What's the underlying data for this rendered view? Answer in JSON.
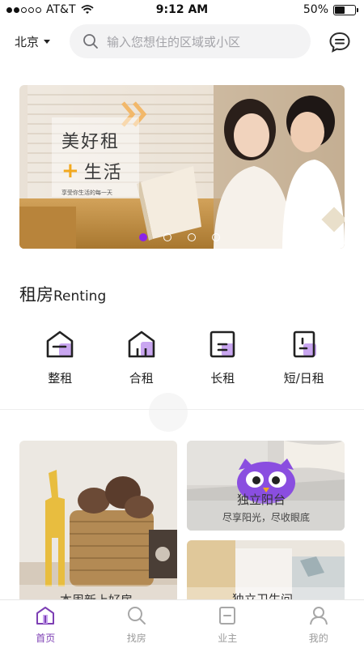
{
  "status_bar": {
    "carrier": "AT&T",
    "time": "9:12 AM",
    "battery": "50%",
    "battery_level": 0.5
  },
  "header": {
    "city": "北京",
    "search_placeholder": "输入您想住的区域或小区",
    "icons": [
      "search-icon",
      "chat-icon",
      "chevron-down-icon"
    ]
  },
  "banner": {
    "title_line1": "美好租",
    "title_plus": "+",
    "title_line2": "生活",
    "subtitle": "享受你生活的每一天",
    "page_count": 4,
    "active_page": 1
  },
  "section": {
    "title_zh": "租房",
    "title_en": "Renting"
  },
  "categories": [
    {
      "label": "整租",
      "icon": "whole-rent-icon"
    },
    {
      "label": "合租",
      "icon": "shared-rent-icon"
    },
    {
      "label": "长租",
      "icon": "long-rent-icon"
    },
    {
      "label": "短/日租",
      "icon": "short-rent-icon"
    }
  ],
  "cards": {
    "big": {
      "title": "本周新上好房"
    },
    "right_top": {
      "title": "独立阳台",
      "subtitle": "尽享阳光，尽收眼底"
    },
    "right_bottom": {
      "title": "独立卫生间"
    }
  },
  "tabs": [
    {
      "label": "首页",
      "icon": "home-icon",
      "active": true
    },
    {
      "label": "找房",
      "icon": "search-icon",
      "active": false
    },
    {
      "label": "业主",
      "icon": "owner-icon",
      "active": false
    },
    {
      "label": "我的",
      "icon": "profile-icon",
      "active": false
    }
  ],
  "colors": {
    "accent": "#8a23e8",
    "tab_active": "#7d3fb4",
    "plus_orange": "#f2a91f",
    "icon_purple": "#c9a6f0"
  }
}
